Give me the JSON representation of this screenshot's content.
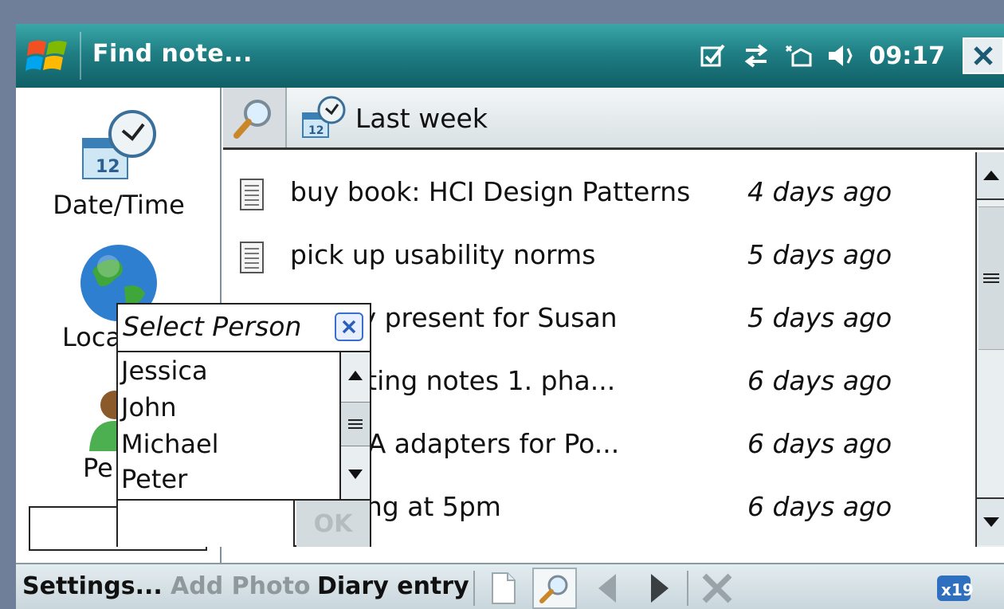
{
  "titlebar": {
    "title": "Find note...",
    "clock": "09:17"
  },
  "left_panel": {
    "items": [
      {
        "label": "Date/Time",
        "icon": "calendar-clock-icon"
      },
      {
        "label": "Loca",
        "icon": "globe-icon"
      },
      {
        "label": "Pe",
        "icon": "person-icon"
      }
    ],
    "input_value": ""
  },
  "filter": {
    "label": "Last week"
  },
  "notes": [
    {
      "title": "buy book: HCI Design Patterns",
      "date": "4 days ago",
      "has_icon": true
    },
    {
      "title": "pick up usability norms",
      "date": "5 days ago",
      "has_icon": true
    },
    {
      "title": "rthday present for Susan",
      "date": "5 days ago",
      "has_icon": false
    },
    {
      "title": "t meeting notes 1. pha...",
      "date": "6 days ago",
      "has_icon": false
    },
    {
      "title": "ch VGA adapters for Po...",
      "date": "6 days ago",
      "has_icon": false
    },
    {
      "title": "meeting at 5pm",
      "date": "6 days ago",
      "has_icon": false
    }
  ],
  "popup": {
    "title": "Select Person",
    "persons": [
      "Jessica",
      "John",
      "Michael",
      "Peter"
    ],
    "ok_label": "OK",
    "input_value": ""
  },
  "menubar": {
    "settings": "Settings...",
    "add_photo": "Add Photo",
    "diary_entry": "Diary entry",
    "badge": "x19"
  },
  "colors": {
    "titlebar": "#1f7f84",
    "background": "#6f7f99",
    "menubar": "#c9d6dc",
    "disabled_text": "#8f989c"
  }
}
